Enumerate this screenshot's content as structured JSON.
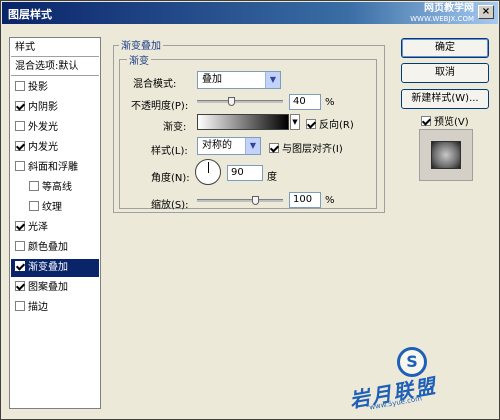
{
  "window": {
    "title": "图层样式",
    "close_glyph": "×",
    "watermark_top": "网页教学网",
    "watermark_top_sub": "WWW.WEBJX.COM"
  },
  "style_list": {
    "header": "样式",
    "blend_options": "混合选项:默认",
    "items": [
      {
        "label": "投影",
        "checked": false,
        "indent": false,
        "selected": false
      },
      {
        "label": "内阴影",
        "checked": true,
        "indent": false,
        "selected": false
      },
      {
        "label": "外发光",
        "checked": false,
        "indent": false,
        "selected": false
      },
      {
        "label": "内发光",
        "checked": true,
        "indent": false,
        "selected": false
      },
      {
        "label": "斜面和浮雕",
        "checked": false,
        "indent": false,
        "selected": false
      },
      {
        "label": "等高线",
        "checked": false,
        "indent": true,
        "selected": false
      },
      {
        "label": "纹理",
        "checked": false,
        "indent": true,
        "selected": false
      },
      {
        "label": "光泽",
        "checked": true,
        "indent": false,
        "selected": false
      },
      {
        "label": "颜色叠加",
        "checked": false,
        "indent": false,
        "selected": false
      },
      {
        "label": "渐变叠加",
        "checked": true,
        "indent": false,
        "selected": true
      },
      {
        "label": "图案叠加",
        "checked": true,
        "indent": false,
        "selected": false
      },
      {
        "label": "描边",
        "checked": false,
        "indent": false,
        "selected": false
      }
    ]
  },
  "panel": {
    "group_title": "渐变叠加",
    "sub_group_title": "渐变",
    "blend_mode_label": "混合模式:",
    "blend_mode_value": "叠加",
    "opacity_label": "不透明度(P):",
    "opacity_value": "40",
    "opacity_fraction": 0.4,
    "percent": "%",
    "gradient_label": "渐变:",
    "reverse_label": "反向(R)",
    "reverse_checked": true,
    "style_label": "样式(L):",
    "style_value": "对称的",
    "align_label": "与图层对齐(I)",
    "align_checked": true,
    "angle_label": "角度(N):",
    "angle_value": "90",
    "degree_unit": "度",
    "scale_label": "缩放(S):",
    "scale_value": "100",
    "scale_fraction": 0.67,
    "percent2": "%"
  },
  "buttons": {
    "ok": "确定",
    "cancel": "取消",
    "new_style": "新建样式(W)...",
    "preview_label": "预览(V)",
    "preview_checked": true
  },
  "logo": {
    "mark": "S",
    "text": "岩月联盟",
    "sub": "www.5yue.com"
  },
  "colors": {
    "title_bar": "#0a246a",
    "selection": "#0a246a",
    "group_title": "#1a3a8a"
  }
}
